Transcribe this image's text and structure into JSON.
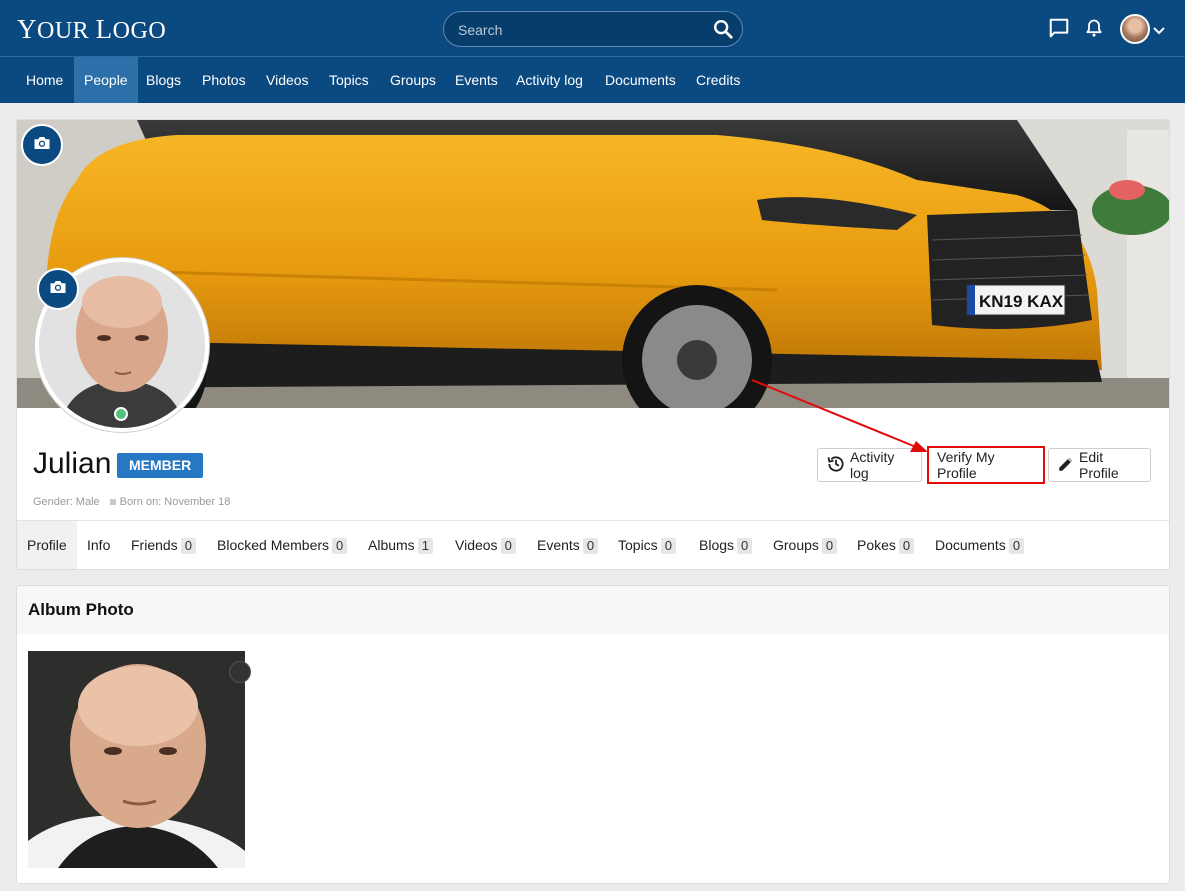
{
  "header": {
    "logo_first": "Y",
    "logo_rest": "OUR ",
    "logo_first2": "L",
    "logo_rest2": "OGO",
    "search_placeholder": "Search"
  },
  "nav": {
    "items": [
      {
        "label": "Home"
      },
      {
        "label": "People"
      },
      {
        "label": "Blogs"
      },
      {
        "label": "Photos"
      },
      {
        "label": "Videos"
      },
      {
        "label": "Topics"
      },
      {
        "label": "Groups"
      },
      {
        "label": "Events"
      },
      {
        "label": "Activity log"
      },
      {
        "label": "Documents"
      },
      {
        "label": "Credits"
      }
    ],
    "active": "People"
  },
  "profile": {
    "name": "Julian",
    "badge": "MEMBER",
    "gender": "Gender: Male",
    "born": "Born on: November 18",
    "cover_plate": "KN19 KAX",
    "buttons": {
      "activity_log": "Activity log",
      "verify": "Verify My Profile",
      "edit": "Edit Profile"
    },
    "tabs": [
      {
        "label": "Profile",
        "count": ""
      },
      {
        "label": "Info",
        "count": ""
      },
      {
        "label": "Friends",
        "count": "0"
      },
      {
        "label": "Blocked Members",
        "count": "0"
      },
      {
        "label": "Albums",
        "count": "1"
      },
      {
        "label": "Videos",
        "count": "0"
      },
      {
        "label": "Events",
        "count": "0"
      },
      {
        "label": "Topics",
        "count": "0"
      },
      {
        "label": "Blogs",
        "count": "0"
      },
      {
        "label": "Groups",
        "count": "0"
      },
      {
        "label": "Pokes",
        "count": "0"
      },
      {
        "label": "Documents",
        "count": "0"
      }
    ]
  },
  "album": {
    "title": "Album Photo"
  },
  "colors": {
    "brand": "#0b4a80",
    "nav_active": "#2d6fa8",
    "badge": "#2778c4",
    "highlight": "#e10b0b",
    "online": "#4fc37a"
  },
  "icons": {
    "search": "search-icon",
    "chat": "chat-icon",
    "bell": "bell-icon",
    "camera": "camera-icon",
    "history": "history-icon",
    "pencil": "pencil-icon"
  }
}
